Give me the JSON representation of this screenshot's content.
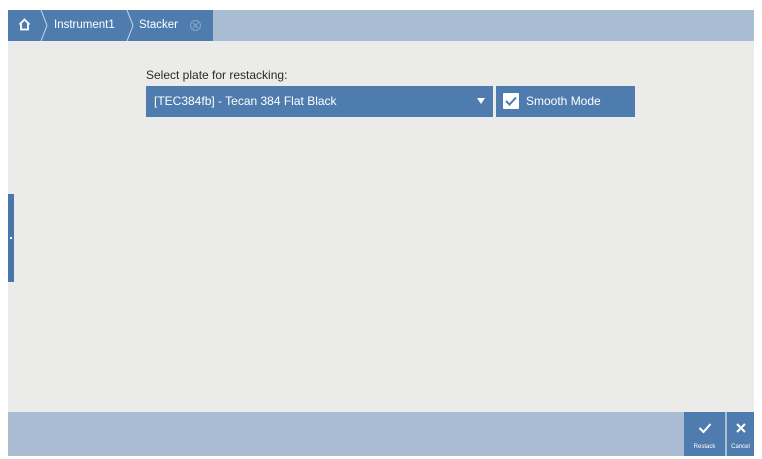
{
  "breadcrumb": {
    "home_icon": "home-icon",
    "items": [
      {
        "label": "Instrument1"
      },
      {
        "label": "Stacker"
      }
    ],
    "close_icon": "close-circle-icon"
  },
  "main": {
    "select_label": "Select plate for restacking:",
    "plate_select": {
      "value": "[TEC384fb] - Tecan 384 Flat Black",
      "icon": "dropdown-caret-icon"
    },
    "smooth_mode": {
      "label": "Smooth Mode",
      "checked": true,
      "icon": "checkbox-checked-icon"
    }
  },
  "actions": {
    "restack": {
      "label": "Restack",
      "icon": "checkmark-icon"
    },
    "cancel": {
      "label": "Cancel",
      "icon": "close-icon"
    }
  },
  "colors": {
    "accent": "#4f7cae",
    "bar": "#a9bcd2",
    "background": "#ebebea"
  }
}
